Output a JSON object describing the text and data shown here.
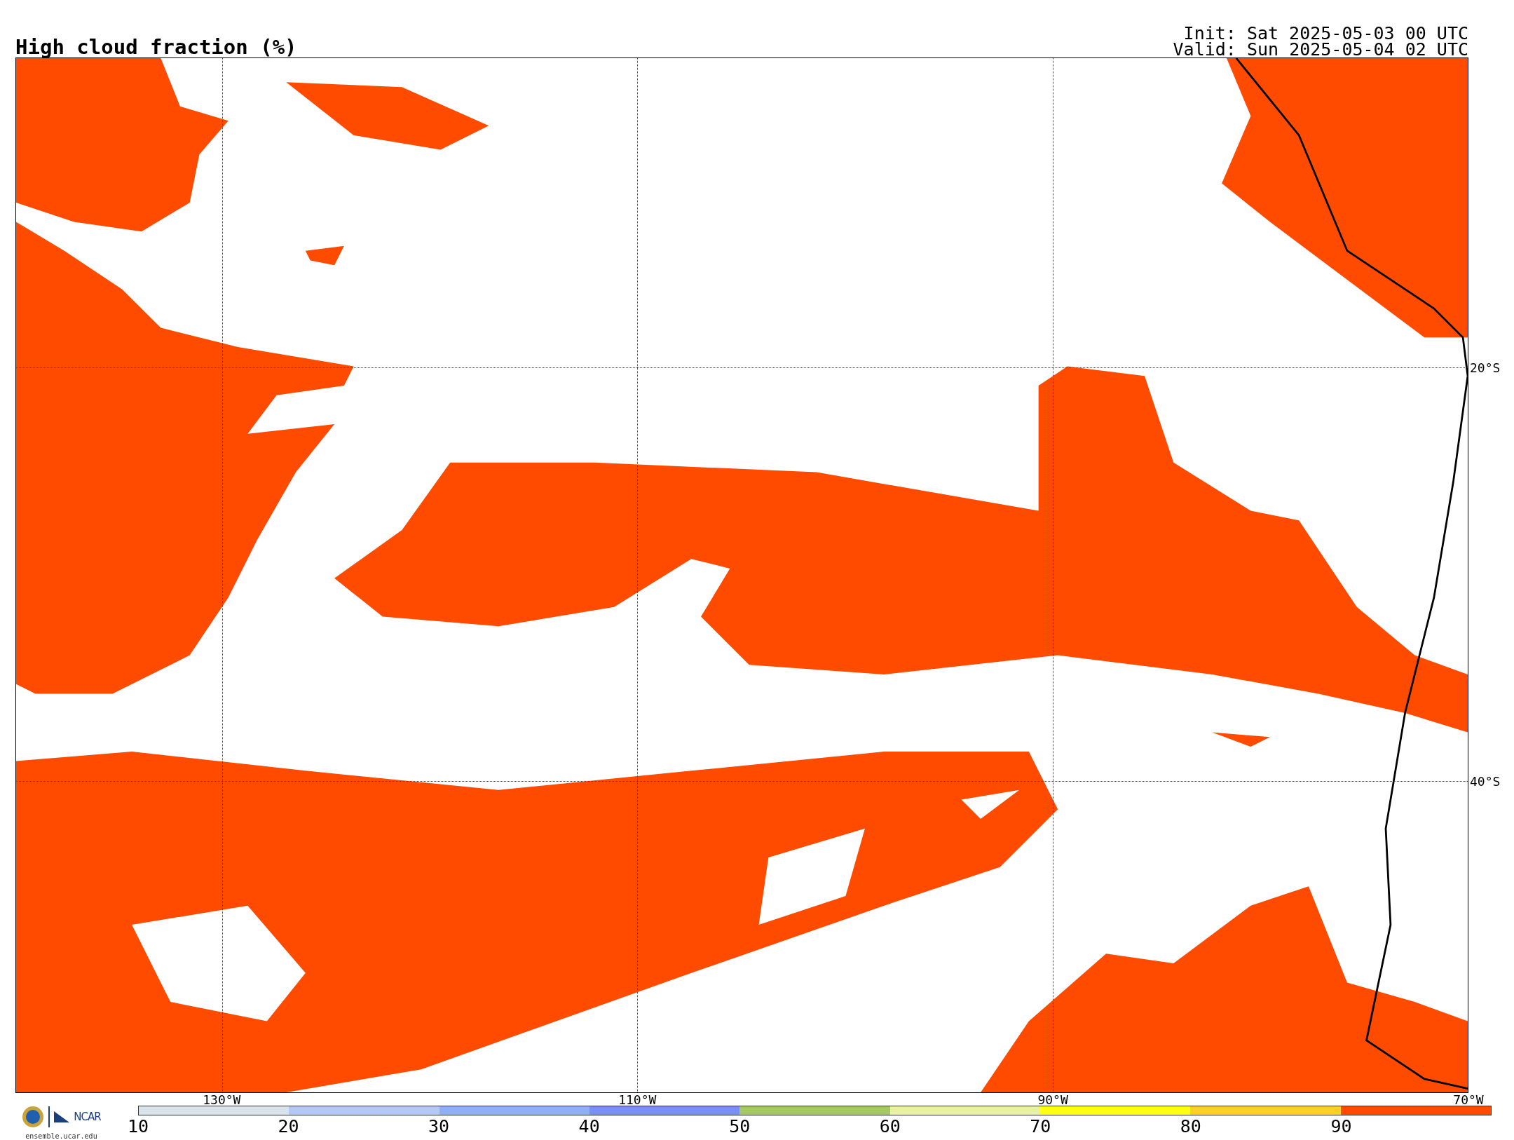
{
  "title": "High cloud fraction (%)",
  "init": "Init: Sat 2025-05-03 00 UTC",
  "valid": "Valid: Sun 2025-05-04 02 UTC",
  "map": {
    "lon_labels": [
      "130°W",
      "110°W",
      "90°W",
      "70°W"
    ],
    "lat_labels": [
      "20°S",
      "40°S"
    ]
  },
  "logos": {
    "ncar": "NCAR",
    "site": "ensemble.ucar.edu"
  },
  "colorbar": {
    "ticks": [
      "10",
      "20",
      "30",
      "40",
      "50",
      "60",
      "70",
      "80",
      "90"
    ],
    "segments": [
      {
        "color": "#d8e3ec"
      },
      {
        "color": "#b5c9f6"
      },
      {
        "color": "#8fb0f7"
      },
      {
        "color": "#7b8ef4"
      },
      {
        "color": "#a6c964"
      },
      {
        "color": "#e8f2a2"
      },
      {
        "color": "#ffff10"
      },
      {
        "color": "#fdd027"
      },
      {
        "color": "#ff4b00"
      }
    ]
  }
}
